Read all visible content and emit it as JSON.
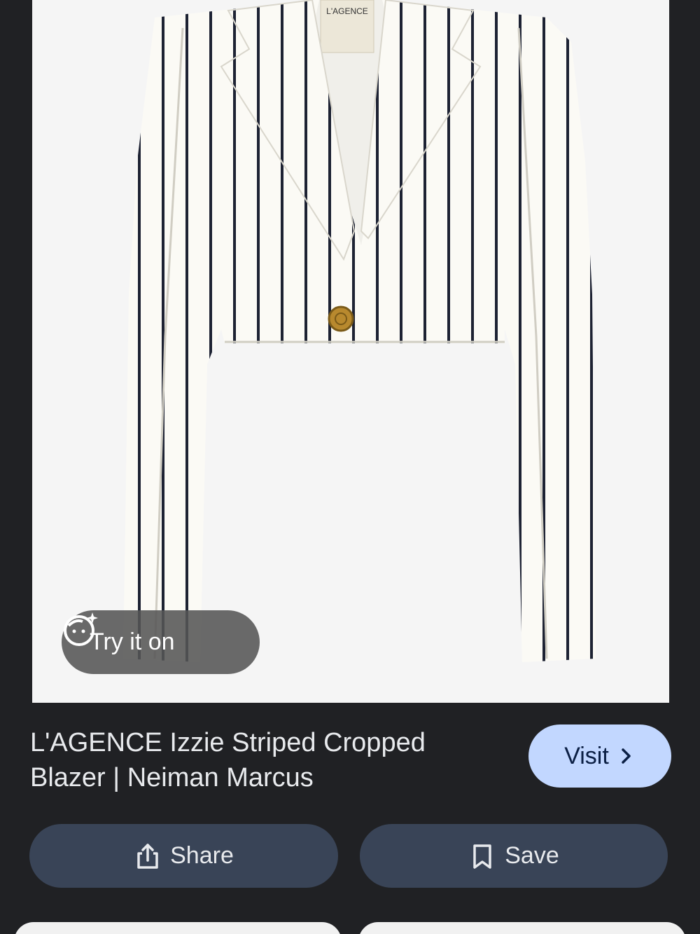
{
  "product": {
    "image_alt_brand_tag": "L'AGENCE",
    "try_on_label": "Try it on",
    "title": "L'AGENCE Izzie Striped Cropped Blazer | Neiman Marcus"
  },
  "actions": {
    "visit_label": "Visit",
    "share_label": "Share",
    "save_label": "Save"
  },
  "colors": {
    "background": "#202124",
    "visit_button": "#c2d7ff",
    "action_button": "#394457"
  }
}
